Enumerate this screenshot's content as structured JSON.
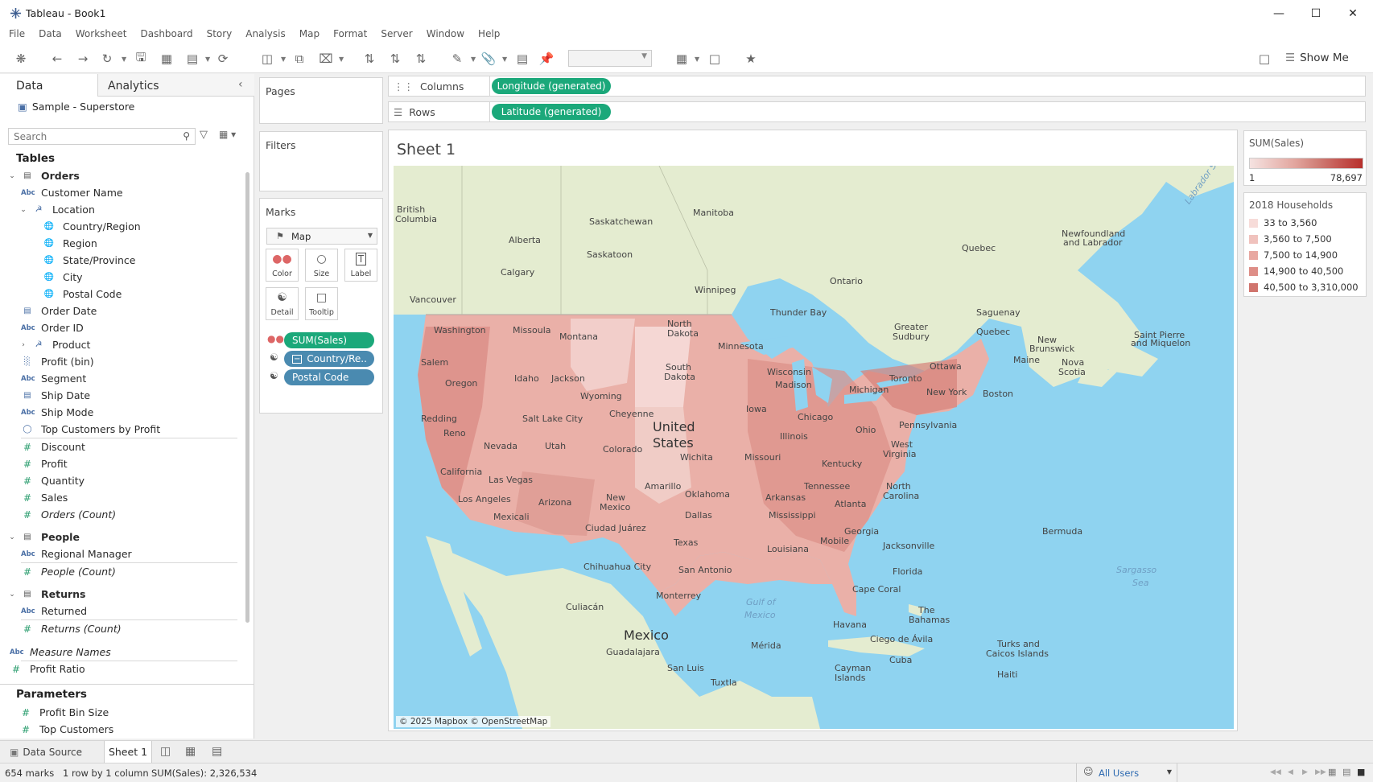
{
  "window": {
    "title": "Tableau - Book1"
  },
  "menu": [
    "File",
    "Data",
    "Worksheet",
    "Dashboard",
    "Story",
    "Analysis",
    "Map",
    "Format",
    "Server",
    "Window",
    "Help"
  ],
  "toolbar": {
    "show_me": "Show Me"
  },
  "data_pane": {
    "tab_data": "Data",
    "tab_analytics": "Analytics",
    "datasource": "Sample - Superstore",
    "search_placeholder": "Search",
    "tables_heading": "Tables",
    "orders": "Orders",
    "fields": {
      "customer_name": "Customer Name",
      "location": "Location",
      "country_region": "Country/Region",
      "region": "Region",
      "state_province": "State/Province",
      "city": "City",
      "postal_code": "Postal Code",
      "order_date": "Order Date",
      "order_id": "Order ID",
      "product": "Product",
      "profit_bin": "Profit (bin)",
      "segment": "Segment",
      "ship_date": "Ship Date",
      "ship_mode": "Ship Mode",
      "top_customers_by_profit": "Top Customers by Profit",
      "discount": "Discount",
      "profit": "Profit",
      "quantity": "Quantity",
      "sales": "Sales",
      "orders_count": "Orders (Count)"
    },
    "people": "People",
    "regional_manager": "Regional Manager",
    "people_count": "People (Count)",
    "returns": "Returns",
    "returned": "Returned",
    "returns_count": "Returns (Count)",
    "measure_names": "Measure Names",
    "profit_ratio": "Profit Ratio",
    "parameters_heading": "Parameters",
    "profit_bin_size": "Profit Bin Size",
    "top_customers": "Top Customers"
  },
  "shelves": {
    "pages": "Pages",
    "filters": "Filters",
    "marks": "Marks",
    "mark_type": "Map",
    "mark_buttons": {
      "color": "Color",
      "size": "Size",
      "label": "Label",
      "detail": "Detail",
      "tooltip": "Tooltip"
    },
    "mark_pills": {
      "sales": "SUM(Sales)",
      "country": "Country/Re..",
      "postal": "Postal Code"
    },
    "columns_label": "Columns",
    "rows_label": "Rows",
    "columns_pill": "Longitude (generated)",
    "rows_pill": "Latitude (generated)"
  },
  "sheet": {
    "title": "Sheet 1",
    "map_credit": "© 2025 Mapbox © OpenStreetMap",
    "labels": {
      "british_columbia_1": "British",
      "british_columbia_2": "Columbia",
      "alberta": "Alberta",
      "saskatchewan": "Saskatchewan",
      "manitoba": "Manitoba",
      "saskatoon": "Saskatoon",
      "calgary": "Calgary",
      "vancouver": "Vancouver",
      "winnipeg": "Winnipeg",
      "ontario": "Ontario",
      "quebec_prov": "Quebec",
      "newfoundland_1": "Newfoundland",
      "newfoundland_2": "and Labrador",
      "thunder_bay": "Thunder Bay",
      "saguenay": "Saguenay",
      "greater_sudbury_1": "Greater",
      "greater_sudbury_2": "Sudbury",
      "quebec_city": "Quebec",
      "new_brunswick_1": "New",
      "new_brunswick_2": "Brunswick",
      "saint_pierre_1": "Saint Pierre",
      "saint_pierre_2": "and Miquelon",
      "nova_scotia_1": "Nova",
      "nova_scotia_2": "Scotia",
      "ottawa": "Ottawa",
      "maine": "Maine",
      "toronto": "Toronto",
      "boston": "Boston",
      "new_york": "New York",
      "washington": "Washington",
      "missoula": "Missoula",
      "montana": "Montana",
      "north_dakota_1": "North",
      "north_dakota_2": "Dakota",
      "minnesota": "Minnesota",
      "salem": "Salem",
      "idaho": "Idaho",
      "jackson": "Jackson",
      "south_dakota_1": "South",
      "south_dakota_2": "Dakota",
      "wisconsin": "Wisconsin",
      "madison": "Madison",
      "michigan": "Michigan",
      "oregon": "Oregon",
      "wyoming": "Wyoming",
      "iowa": "Iowa",
      "chicago": "Chicago",
      "ohio": "Ohio",
      "pennsylvania": "Pennsylvania",
      "cheyenne": "Cheyenne",
      "redding": "Redding",
      "salt_lake": "Salt Lake City",
      "united_states_1": "United",
      "united_states_2": "States",
      "illinois": "Illinois",
      "reno": "Reno",
      "nevada": "Nevada",
      "utah": "Utah",
      "colorado": "Colorado",
      "wichita": "Wichita",
      "missouri": "Missouri",
      "west_virginia_1": "West",
      "west_virginia_2": "Virginia",
      "kentucky": "Kentucky",
      "california": "California",
      "las_vegas": "Las Vegas",
      "tennessee": "Tennessee",
      "amarillo": "Amarillo",
      "oklahoma": "Oklahoma",
      "north_carolina_1": "North",
      "north_carolina_2": "Carolina",
      "los_angeles": "Los Angeles",
      "arizona": "Arizona",
      "new_mexico_1": "New",
      "new_mexico_2": "Mexico",
      "arkansas": "Arkansas",
      "atlanta": "Atlanta",
      "mexicali": "Mexicali",
      "dallas": "Dallas",
      "mississippi": "Mississippi",
      "georgia": "Georgia",
      "ciudad_juarez": "Ciudad Juárez",
      "texas": "Texas",
      "louisiana": "Louisiana",
      "mobile": "Mobile",
      "jacksonville": "Jacksonville",
      "bermuda": "Bermuda",
      "chihuahua": "Chihuahua City",
      "san_antonio": "San Antonio",
      "florida": "Florida",
      "sargasso_1": "Sargasso",
      "sargasso_2": "Sea",
      "cape_coral": "Cape Coral",
      "monterrey": "Monterrey",
      "gulf_1": "Gulf of",
      "gulf_2": "Mexico",
      "the_bahamas_1": "The",
      "the_bahamas_2": "Bahamas",
      "culiacan": "Culiacán",
      "havana": "Havana",
      "mexico": "Mexico",
      "ciego": "Ciego de Ávila",
      "turks_1": "Turks and",
      "turks_2": "Caicos Islands",
      "guadalajara": "Guadalajara",
      "merida": "Mérida",
      "cuba": "Cuba",
      "san_luis": "San Luis",
      "cayman_1": "Cayman",
      "cayman_2": "Islands",
      "tuxtla": "Tuxtla",
      "haiti": "Haiti",
      "baffin": "Labrador Sea"
    }
  },
  "legend_sales": {
    "title": "SUM(Sales)",
    "min": "1",
    "max": "78,697"
  },
  "legend_households": {
    "title": "2018 Households",
    "items": [
      {
        "label": "33 to 3,560",
        "color": "#f7dcd9"
      },
      {
        "label": "3,560 to 7,500",
        "color": "#f0c2bd"
      },
      {
        "label": "7,500 to 14,900",
        "color": "#e8a8a1"
      },
      {
        "label": "14,900 to 40,500",
        "color": "#de8e87"
      },
      {
        "label": "40,500 to 3,310,000",
        "color": "#d0746d"
      }
    ]
  },
  "tabs": {
    "data_source": "Data Source",
    "sheet1": "Sheet 1"
  },
  "status": {
    "marks": "654 marks",
    "dims": "1 row by 1 column",
    "sum": "SUM(Sales): 2,326,534",
    "users": "All Users"
  },
  "colors": {
    "accent_green": "#1ba87a",
    "pill_blue": "#4a8ab0",
    "water": "#8fd3f0",
    "land": "#e6edd3"
  }
}
